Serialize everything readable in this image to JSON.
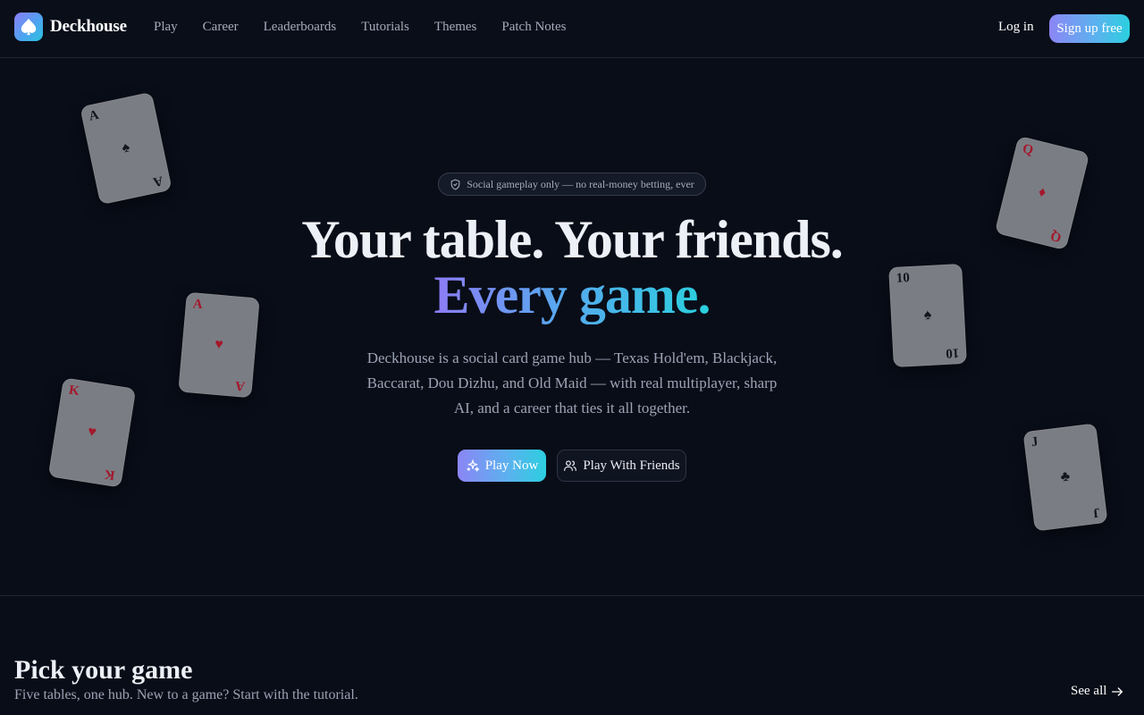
{
  "nav": {
    "brand": "Deckhouse",
    "links": [
      "Play",
      "Career",
      "Leaderboards",
      "Tutorials",
      "Themes",
      "Patch Notes"
    ],
    "login": "Log in",
    "signup": "Sign up free"
  },
  "hero": {
    "badge": "Social gameplay only — no real-money betting, ever",
    "headline_line1": "Your table. Your friends.",
    "headline_line2": "Every game.",
    "lede": "Deckhouse is a social card game hub — Texas Hold'em, Blackjack, Baccarat, Dou Dizhu, and Old Maid — with real multiplayer, sharp AI, and a career that ties it all together.",
    "play_now": "Play Now",
    "play_with_friends": "Play With Friends",
    "cards": [
      {
        "rank": "A",
        "suit": "♠",
        "color": "black"
      },
      {
        "rank": "A",
        "suit": "♥",
        "color": "red"
      },
      {
        "rank": "K",
        "suit": "♥",
        "color": "red"
      },
      {
        "rank": "Q",
        "suit": "♦",
        "color": "red"
      },
      {
        "rank": "10",
        "suit": "♠",
        "color": "black"
      },
      {
        "rank": "J",
        "suit": "♣",
        "color": "black"
      }
    ]
  },
  "games_section": {
    "title": "Pick your game",
    "subtitle": "Five tables, one hub. New to a game? Start with the tutorial.",
    "see_all": "See all"
  },
  "colors": {
    "background": "#090d18",
    "accent_gradient_start": "#8b86f5",
    "accent_gradient_end": "#2ccfe0",
    "card_face": "#7b7d84",
    "red_suit": "#a3182b"
  },
  "icons": {
    "brand_logo": "spade-icon",
    "badge": "shield-icon",
    "play_now": "sparkles-icon",
    "play_with_friends": "users-icon",
    "see_all": "arrow-right-icon"
  }
}
